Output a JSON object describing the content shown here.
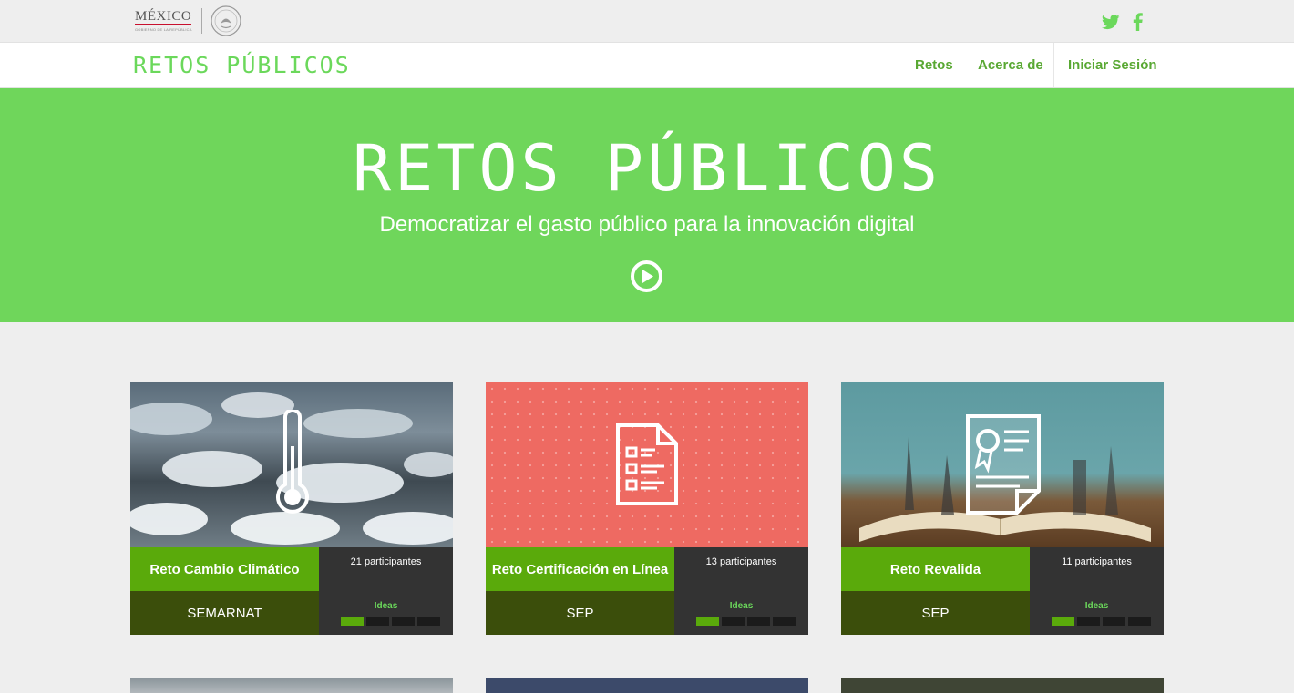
{
  "gov": {
    "name": "MÉXICO",
    "sub": "GOBIERNO DE LA REPÚBLICA"
  },
  "social": {
    "twitter_icon": "twitter-icon",
    "facebook_icon": "facebook-icon",
    "color": "#6bd85b"
  },
  "nav": {
    "brand": "RETOS PÚBLICOS",
    "links": [
      "Retos",
      "Acerca de"
    ],
    "login": "Iniciar Sesión"
  },
  "hero": {
    "title": "RETOS PÚBLICOS",
    "subtitle": "Democratizar el gasto público para la innovación digital",
    "play_icon": "play-circle-icon",
    "color": "#6fd65b"
  },
  "cards": [
    {
      "title": "Reto Cambio Climático",
      "agency": "SEMARNAT",
      "participants": "21 participantes",
      "stage": "Ideas",
      "progress": 0.25,
      "icon": "thermometer-icon"
    },
    {
      "title": "Reto Certificación en Línea",
      "agency": "SEP",
      "participants": "13 participantes",
      "stage": "Ideas",
      "progress": 0.25,
      "icon": "checklist-document-icon"
    },
    {
      "title": "Reto Revalida",
      "agency": "SEP",
      "participants": "11 participantes",
      "stage": "Ideas",
      "progress": 0.25,
      "icon": "certificate-icon"
    }
  ],
  "colors": {
    "accent": "#6bd85b",
    "title_bg": "#5aaa0b",
    "agency_bg": "#3b4e0b",
    "stats_bg": "#333333"
  }
}
